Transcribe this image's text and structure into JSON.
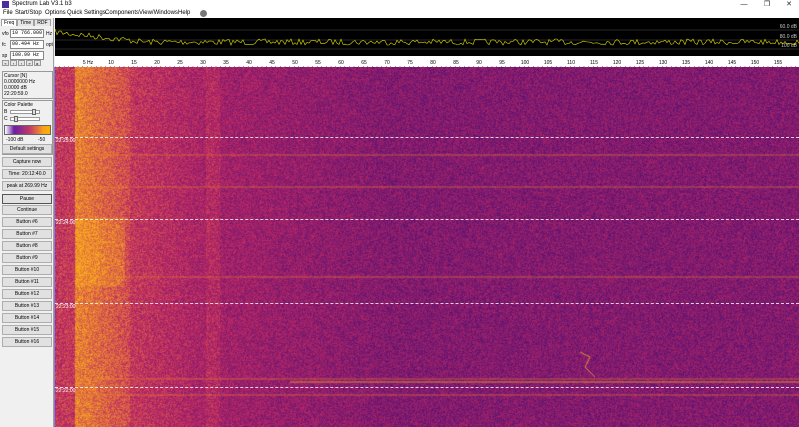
{
  "window": {
    "title": "Spectrum Lab V3.1 b3",
    "controls": [
      "—",
      "❐",
      "✕"
    ]
  },
  "menu": [
    {
      "label": "File"
    },
    {
      "label": "Start/Stop"
    },
    {
      "label": "Options"
    },
    {
      "label": "Quick Settings"
    },
    {
      "label": "Components"
    },
    {
      "label": "View/Windows"
    },
    {
      "label": "Help"
    }
  ],
  "left_panel": {
    "tabs": [
      "Freq",
      "Time",
      "RDF"
    ],
    "vfo": {
      "label": "vfo",
      "value": "10 766.000",
      "unit": "Hz"
    },
    "fc": {
      "label": "fc",
      "value": "00.494 Hz",
      "unit": "opt"
    },
    "sp": {
      "label": "sp",
      "value": "100.99 Hz"
    },
    "cursor": {
      "title": "Cursor [N]",
      "freq": "0.0000000 Hz",
      "level": "0.0000 dB",
      "time": "22:20:59.0"
    },
    "palette": {
      "title": "Color Palette",
      "b_label": "B",
      "c_label": "C",
      "scale_min": "-100 dB",
      "scale_max": "-50"
    },
    "buttons": [
      {
        "label": "Default settings"
      },
      {
        "label": "Capture now"
      },
      {
        "label": "Time: 20:12:40.0"
      },
      {
        "label": "peak at 269.99 Hz"
      },
      {
        "label": "Pause"
      },
      {
        "label": "Continue"
      },
      {
        "label": "Button #6"
      },
      {
        "label": "Button #7"
      },
      {
        "label": "Button #8"
      },
      {
        "label": "Button #9"
      },
      {
        "label": "Button #10"
      },
      {
        "label": "Button #11"
      },
      {
        "label": "Button #12"
      },
      {
        "label": "Button #13"
      },
      {
        "label": "Button #14"
      },
      {
        "label": "Button #15"
      },
      {
        "label": "Button #16"
      }
    ]
  },
  "spectrum": {
    "db_labels": [
      "60.0 dB",
      "80.0 dB",
      "100 dB"
    ]
  },
  "freq_axis": {
    "ticks": [
      "5 Hz",
      "10",
      "15",
      "20",
      "25",
      "30",
      "35",
      "40",
      "45",
      "50",
      "55",
      "60",
      "65",
      "70",
      "75",
      "80",
      "85",
      "90",
      "95",
      "100",
      "105",
      "110",
      "115",
      "120",
      "125",
      "130",
      "135",
      "140",
      "145",
      "150",
      "155"
    ]
  },
  "waterfall": {
    "time_marks": [
      "22:25:00",
      "22:24:00",
      "22:23:00",
      "22:22:00"
    ]
  },
  "colors": {
    "waterfall_bg": "#4a0f75",
    "hot": "#f5a020",
    "spectrum_trace": "#e0e000"
  }
}
